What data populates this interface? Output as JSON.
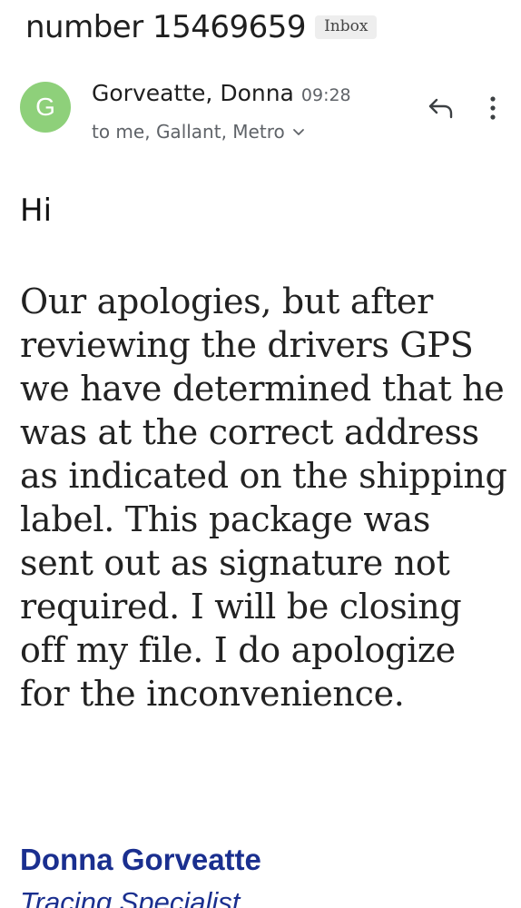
{
  "email": {
    "subject": "number 15469659",
    "label": "Inbox",
    "sender": {
      "name": "Gorveatte, Donna",
      "avatar_letter": "G",
      "avatar_color": "#8ed07a",
      "time": "09:28",
      "recipients": "to me, Gallant, Metro"
    },
    "actions": {
      "reply_icon": "reply-icon",
      "more_icon": "more-vert-icon"
    },
    "body": {
      "greeting": "Hi",
      "message": "Our apologies, but after reviewing the drivers GPS we have determined that he was at the correct address as indicated on the shipping label. This package was sent out as signature not required. I will be closing off my file. I do apologize for the inconvenience."
    },
    "signature": {
      "name": "Donna Gorveatte",
      "title": "Tracing Specialist",
      "color": "#1a2f8f"
    }
  }
}
